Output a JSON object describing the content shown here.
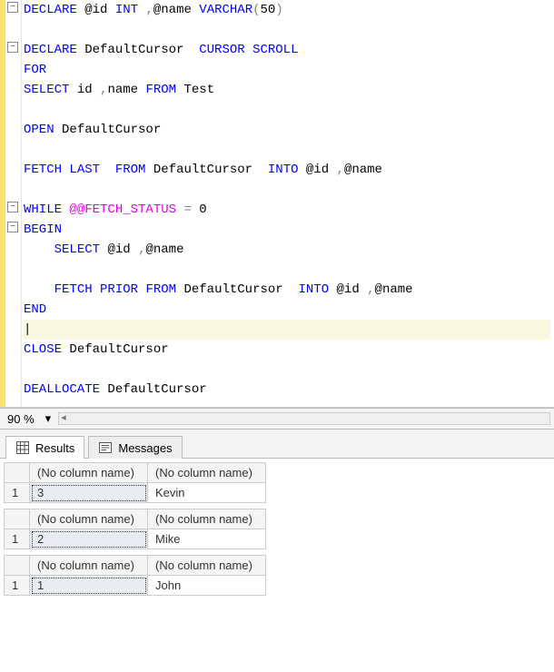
{
  "code": {
    "declare1": {
      "kw": "DECLARE",
      "v1": "@id",
      "t1": "INT",
      "comma": ",",
      "v2": "@name",
      "t2": "VARCHAR",
      "paren_open": "(",
      "sz": "50",
      "paren_close": ")"
    },
    "declare2": {
      "kw": "DECLARE",
      "name": "DefaultCursor",
      "cur": "CURSOR",
      "scroll": "SCROLL"
    },
    "for": "FOR",
    "select_src": {
      "kw": "SELECT",
      "c1": "id",
      "comma": ",",
      "c2": "name",
      "from": "FROM",
      "tbl": "Test"
    },
    "open": {
      "kw": "OPEN",
      "name": "DefaultCursor"
    },
    "fetch_last": {
      "kw": "FETCH",
      "dir": "LAST",
      "from": "FROM",
      "cur": "DefaultCursor",
      "into": "INTO",
      "v1": "@id",
      "comma": ",",
      "v2": "@name"
    },
    "while": {
      "kw": "WHILE",
      "sys": "@@FETCH_STATUS",
      "eq": "=",
      "val": "0"
    },
    "begin": "BEGIN",
    "select_vars": {
      "kw": "SELECT",
      "v1": "@id",
      "comma": ",",
      "v2": "@name"
    },
    "fetch_prior": {
      "kw": "FETCH",
      "dir": "PRIOR",
      "from": "FROM",
      "cur": "DefaultCursor",
      "into": "INTO",
      "v1": "@id",
      "comma": ",",
      "v2": "@name"
    },
    "end": "END",
    "close": {
      "kw": "CLOSE",
      "name": "DefaultCursor"
    },
    "dealloc": {
      "kw": "DEALLOCATE",
      "name": "DefaultCursor"
    }
  },
  "zoom": {
    "value": "90 %"
  },
  "tabs": {
    "results": "Results",
    "messages": "Messages"
  },
  "results": {
    "col_header": "(No column name)",
    "rownum": "1",
    "sets": [
      {
        "c1": "3",
        "c2": "Kevin"
      },
      {
        "c1": "2",
        "c2": "Mike"
      },
      {
        "c1": "1",
        "c2": "John"
      }
    ]
  }
}
